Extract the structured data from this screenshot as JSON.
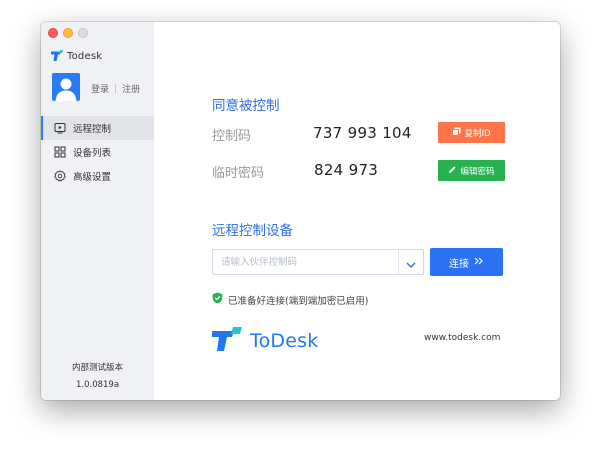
{
  "app": {
    "title": "Todesk",
    "logo_text": "ToDesk",
    "url": "www.todesk.com"
  },
  "sidebar": {
    "login_label": "登录",
    "register_label": "注册",
    "items": [
      {
        "label": "远程控制",
        "icon": "remote-control-icon",
        "active": true
      },
      {
        "label": "设备列表",
        "icon": "device-grid-icon",
        "active": false
      },
      {
        "label": "高级设置",
        "icon": "gear-icon",
        "active": false
      }
    ],
    "version_label": "内部测试版本",
    "version_number": "1.0.0819a"
  },
  "allow_control": {
    "title": "同意被控制",
    "code_label": "控制码",
    "code_value": "737 993 104",
    "copy_button": "复制ID",
    "password_label": "临时密码",
    "password_value": "824 973",
    "edit_button": "编辑密码"
  },
  "remote_control": {
    "title": "远程控制设备",
    "input_placeholder": "请输入伙伴控制码",
    "input_value": "",
    "connect_button": "连接",
    "status_text": "已准备好连接(端到端加密已启用)"
  },
  "colors": {
    "accent": "#2a72f2",
    "copy_button": "#ff7449",
    "edit_button": "#27b24e",
    "status_ok": "#27b24e",
    "sidebar_bg": "#f0f1f4"
  }
}
